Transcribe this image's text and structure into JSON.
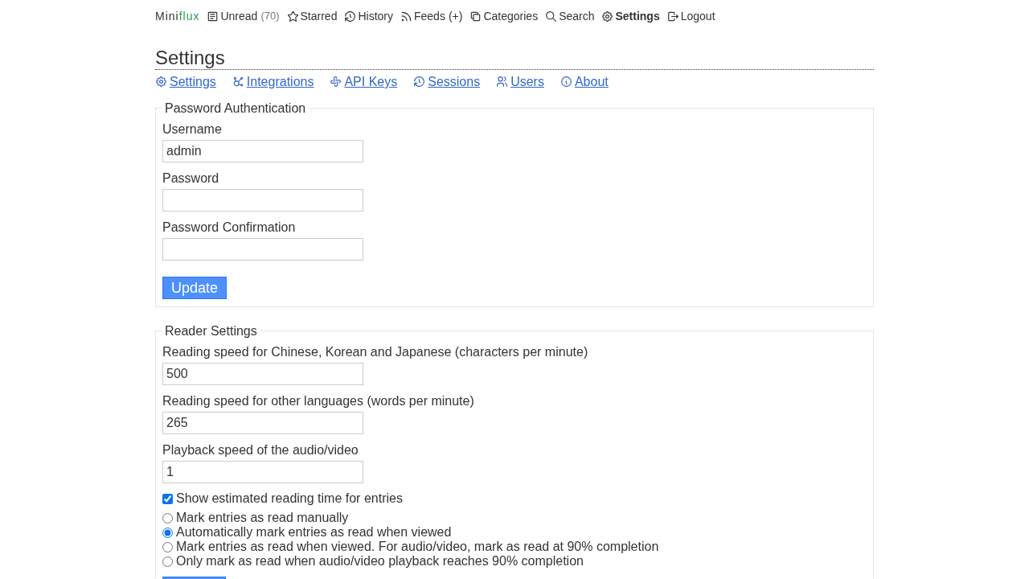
{
  "header": {
    "logo": {
      "main": "Mini",
      "accent": "flux"
    },
    "menu": [
      {
        "label": "Unread",
        "count": "(70)",
        "selected": false
      },
      {
        "label": "Starred",
        "selected": false
      },
      {
        "label": "History",
        "selected": false
      },
      {
        "label": "Feeds",
        "add_link": "(+)",
        "selected": false
      },
      {
        "label": "Categories",
        "selected": false
      },
      {
        "label": "Search",
        "selected": false
      },
      {
        "label": "Settings",
        "selected": true
      },
      {
        "label": "Logout",
        "selected": false
      }
    ]
  },
  "page_title": "Settings",
  "sub_nav": [
    {
      "label": "Settings"
    },
    {
      "label": "Integrations"
    },
    {
      "label": "API Keys"
    },
    {
      "label": "Sessions"
    },
    {
      "label": "Users"
    },
    {
      "label": "About"
    }
  ],
  "sections": [
    {
      "legend": "Password Authentication",
      "fields": [
        {
          "kind": "text",
          "label": "Username",
          "value": "admin"
        },
        {
          "kind": "password",
          "label": "Password"
        },
        {
          "kind": "password",
          "label": "Password Confirmation"
        }
      ],
      "button": "Update"
    },
    {
      "legend": "Reader Settings",
      "fields": [
        {
          "kind": "number",
          "label": "Reading speed for Chinese, Korean and Japanese (characters per minute)",
          "value": "500"
        },
        {
          "kind": "number",
          "label": "Reading speed for other languages (words per minute)",
          "value": "265"
        },
        {
          "kind": "number",
          "label": "Playback speed of the audio/video",
          "value": "1"
        },
        {
          "kind": "checkbox",
          "label": "Show estimated reading time for entries",
          "checked": true
        }
      ],
      "radio_options": [
        {
          "label": "Mark entries as read manually",
          "selected": false
        },
        {
          "label": "Automatically mark entries as read when viewed",
          "selected": true
        },
        {
          "label": "Mark entries as read when viewed. For audio/video, mark as read at 90% completion",
          "selected": false
        },
        {
          "label": "Only mark as read when audio/video playback reaches 90% completion",
          "selected": false
        }
      ]
    }
  ]
}
